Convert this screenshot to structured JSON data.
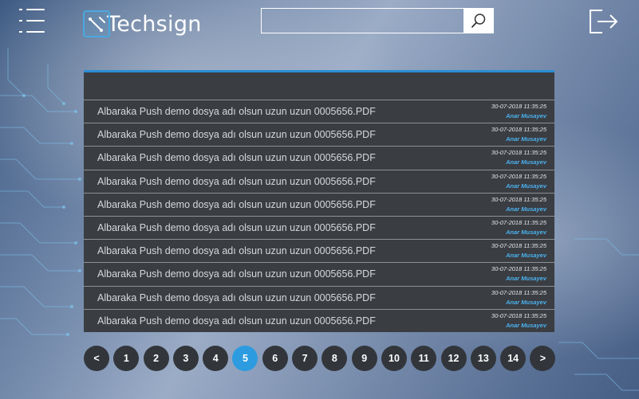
{
  "brand": {
    "name": "Techsign"
  },
  "search": {
    "value": "",
    "placeholder": ""
  },
  "documents": [
    {
      "name": "Albaraka Push demo dosya adı olsun uzun uzun 0005656.PDF",
      "date": "30-07-2018 11:35:25",
      "user": "Anar Musayev"
    },
    {
      "name": "Albaraka Push demo dosya adı olsun uzun uzun 0005656.PDF",
      "date": "30-07-2018 11:35:25",
      "user": "Anar Musayev"
    },
    {
      "name": "Albaraka Push demo dosya adı olsun uzun uzun 0005656.PDF",
      "date": "30-07-2018 11:35:25",
      "user": "Anar Musayev"
    },
    {
      "name": "Albaraka Push demo dosya adı olsun uzun uzun 0005656.PDF",
      "date": "30-07-2018 11:35:25",
      "user": "Anar Musayev"
    },
    {
      "name": "Albaraka Push demo dosya adı olsun uzun uzun 0005656.PDF",
      "date": "30-07-2018 11:35:25",
      "user": "Anar Musayev"
    },
    {
      "name": "Albaraka Push demo dosya adı olsun uzun uzun 0005656.PDF",
      "date": "30-07-2018 11:35:25",
      "user": "Anar Musayev"
    },
    {
      "name": "Albaraka Push demo dosya adı olsun uzun uzun 0005656.PDF",
      "date": "30-07-2018 11:35:25",
      "user": "Anar Musayev"
    },
    {
      "name": "Albaraka Push demo dosya adı olsun uzun uzun 0005656.PDF",
      "date": "30-07-2018 11:35:25",
      "user": "Anar Musayev"
    },
    {
      "name": "Albaraka Push demo dosya adı olsun uzun uzun 0005656.PDF",
      "date": "30-07-2018 11:35:25",
      "user": "Anar Musayev"
    },
    {
      "name": "Albaraka Push demo dosya adı olsun uzun uzun 0005656.PDF",
      "date": "30-07-2018 11:35:25",
      "user": "Anar Musayev"
    }
  ],
  "pagination": {
    "prev_label": "<",
    "next_label": ">",
    "pages": [
      "1",
      "2",
      "3",
      "4",
      "5",
      "6",
      "7",
      "8",
      "9",
      "10",
      "11",
      "12",
      "13",
      "14"
    ],
    "current": "5"
  },
  "icons": {
    "menu": "hamburger-menu-icon",
    "search": "magnifier-icon",
    "logout": "logout-icon",
    "logo": "techsign-logo-icon"
  },
  "colors": {
    "accent": "#2d9be0",
    "panel": "#3a3d42",
    "user_text": "#4bb2f0",
    "pager_bg": "#32363b"
  }
}
